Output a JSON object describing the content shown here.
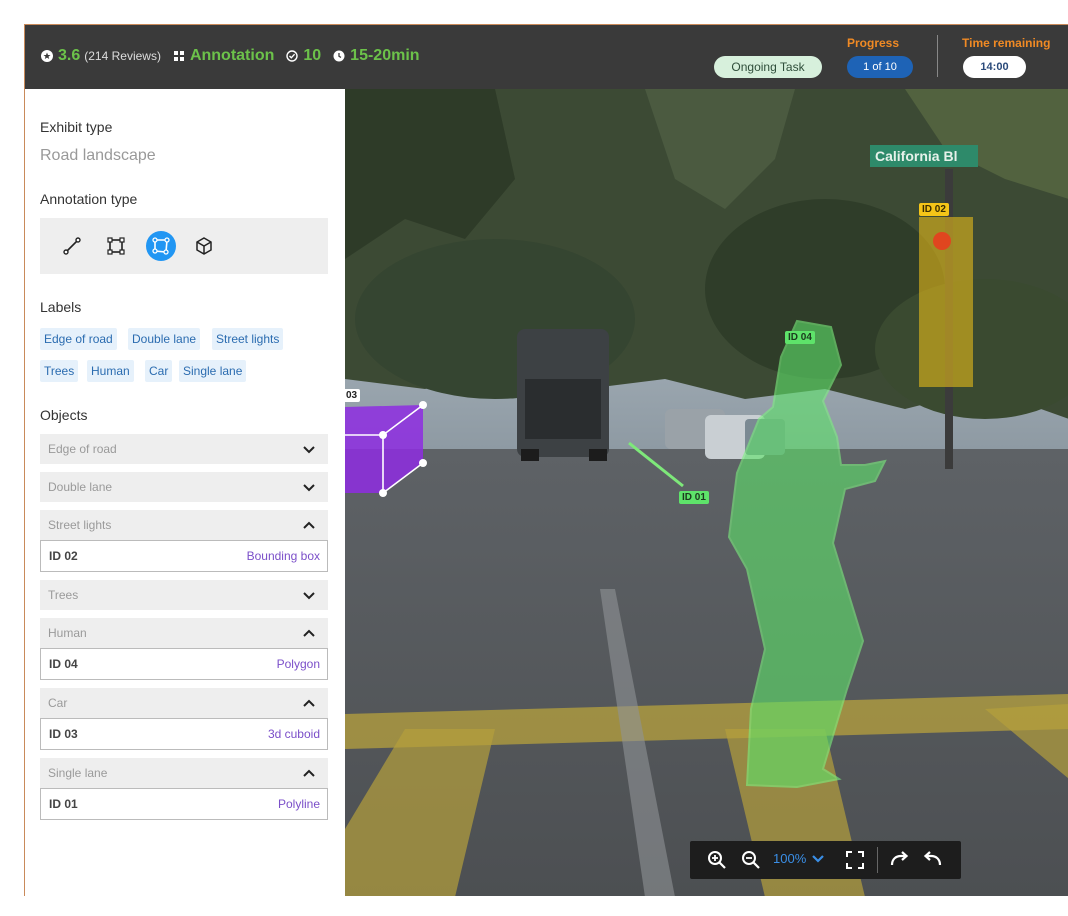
{
  "header": {
    "rating": "3.6",
    "reviews": "(214 Reviews)",
    "category": "Annotation",
    "count": "10",
    "duration": "15-20min",
    "status": "Ongoing Task",
    "progress_label": "Progress",
    "progress_value": "1 of 10",
    "time_label": "Time remaining",
    "time_value": "14:00"
  },
  "sidebar": {
    "exhibit_label": "Exhibit type",
    "exhibit_value": "Road landscape",
    "annotation_label": "Annotation type",
    "tools": [
      "polyline-icon",
      "bounding-box-icon",
      "polygon-icon",
      "cuboid-icon"
    ],
    "labels_title": "Labels",
    "labels": [
      "Edge of road",
      "Double lane",
      "Street lights",
      "Trees",
      "Human",
      "Car",
      "Single lane"
    ],
    "objects_title": "Objects",
    "objects": [
      {
        "name": "Edge of road",
        "expanded": false
      },
      {
        "name": "Double lane",
        "expanded": false
      },
      {
        "name": "Street lights",
        "expanded": true,
        "id": "ID 02",
        "kind": "Bounding box"
      },
      {
        "name": "Trees",
        "expanded": false
      },
      {
        "name": "Human",
        "expanded": true,
        "id": "ID 04",
        "kind": "Polygon"
      },
      {
        "name": "Car",
        "expanded": true,
        "id": "ID 03",
        "kind": "3d cuboid"
      },
      {
        "name": "Single lane",
        "expanded": true,
        "id": "ID 01",
        "kind": "Polyline"
      }
    ]
  },
  "canvas": {
    "street_sign": "California Bl",
    "tags": {
      "id01": "ID 01",
      "id02": "ID 02",
      "id03": "03",
      "id04": "ID 04"
    },
    "zoom": "100%",
    "colors": {
      "polygon": "#5ee36a",
      "bbox": "#f5c518",
      "cuboid": "#8e2de2",
      "polyline": "#7ee87a"
    }
  }
}
